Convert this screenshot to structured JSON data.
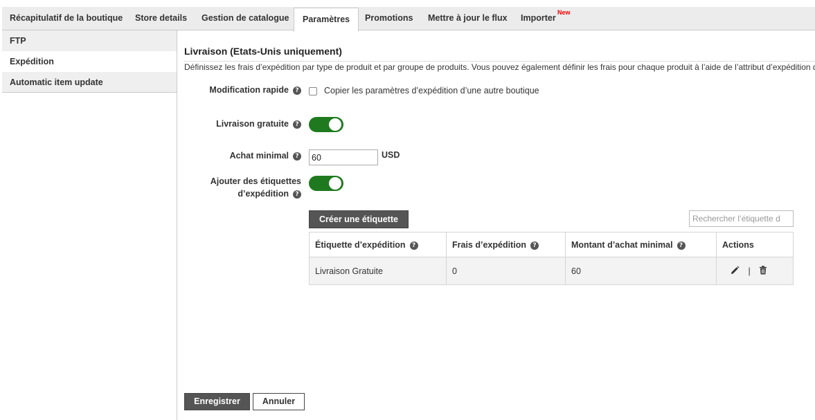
{
  "tabs": [
    {
      "label": "Récapitulatif de la boutique"
    },
    {
      "label": "Store details"
    },
    {
      "label": "Gestion de catalogue"
    },
    {
      "label": "Paramètres",
      "active": true
    },
    {
      "label": "Promotions"
    },
    {
      "label": "Mettre à jour le flux"
    },
    {
      "label": "Importer",
      "badge": "New"
    }
  ],
  "sidebar": {
    "items": [
      {
        "label": "FTP"
      },
      {
        "label": "Expédition"
      },
      {
        "label": "Automatic item update"
      }
    ]
  },
  "section": {
    "title": "Livraison (Etats-Unis uniquement)",
    "description": "Définissez les frais d’expédition par type de produit et par groupe de produits. Vous pouvez également définir les frais pour chaque produit à l’aide de l’attribut d’expédition d"
  },
  "form": {
    "quick_edit": {
      "label": "Modification rapide",
      "checkbox_label": "Copier les paramètres d’expédition d’une autre boutique",
      "checked": false
    },
    "free_shipping": {
      "label": "Livraison gratuite",
      "on": true
    },
    "min_purchase": {
      "label": "Achat minimal",
      "value": "60",
      "unit": "USD"
    },
    "add_labels": {
      "label_line1": "Ajouter des étiquettes",
      "label_line2": "d’expédition",
      "on": true
    }
  },
  "labels_table": {
    "create_button": "Créer une étiquette",
    "search_placeholder": "Rechercher l’étiquette d",
    "headers": [
      "Étiquette d’expédition",
      "Frais d’expédition",
      "Montant d’achat minimal",
      "Actions"
    ],
    "rows": [
      {
        "label": "Livraison Gratuite",
        "fee": "0",
        "min_amount": "60"
      }
    ],
    "action_separator": "|"
  },
  "footer": {
    "save": "Enregistrer",
    "cancel": "Annuler"
  },
  "help_glyph": "?",
  "colors": {
    "toggle_on": "#1f7a1f",
    "dark_button": "#555555",
    "badge": "#ee0000"
  }
}
